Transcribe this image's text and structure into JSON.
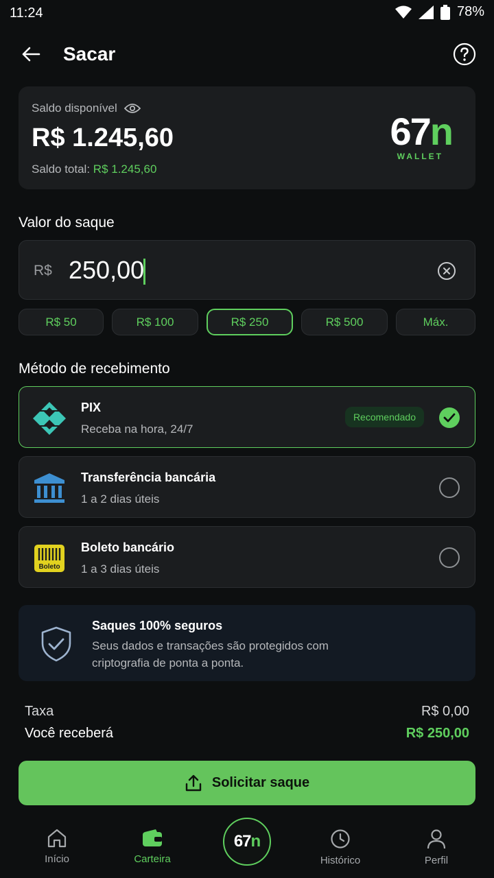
{
  "status_bar": {
    "time": "11:24",
    "battery": "78%"
  },
  "header": {
    "title": "Sacar"
  },
  "balance": {
    "label": "Saldo disponível",
    "value": "R$ 1.245,60",
    "total_label": "Saldo total:",
    "total_value": "R$ 1.245,60",
    "logo_main": "67",
    "logo_n": "n",
    "logo_sub": "WALLET"
  },
  "amount": {
    "section_title": "Valor do saque",
    "currency": "R$",
    "value": "250,00",
    "chips": [
      "R$ 50",
      "R$ 100",
      "R$ 250",
      "R$ 500",
      "Máx."
    ],
    "selected_chip": "R$ 250"
  },
  "methods": {
    "section_title": "Método de recebimento",
    "items": [
      {
        "title": "PIX",
        "subtitle": "Receba na hora, 24/7",
        "badge": "Recomendado",
        "selected": true,
        "icon": "pix-icon"
      },
      {
        "title": "Transferência bancária",
        "subtitle": "1 a 2 dias úteis",
        "selected": false,
        "icon": "bank-icon"
      },
      {
        "title": "Boleto bancário",
        "subtitle": "1 a 3 dias úteis",
        "selected": false,
        "icon": "boleto-icon",
        "icon_text": "Boleto"
      }
    ]
  },
  "security": {
    "title": "Saques 100% seguros",
    "body": "Seus dados e transações são protegidos com criptografia de ponta a ponta."
  },
  "summary": {
    "fee_label": "Taxa",
    "fee_value": "R$ 0,00",
    "receive_label": "Você receberá",
    "receive_value": "R$ 250,00"
  },
  "cta": {
    "label": "Solicitar saque"
  },
  "nav": {
    "items": [
      {
        "label": "Início",
        "icon": "home-icon"
      },
      {
        "label": "Carteira",
        "icon": "wallet-icon",
        "active": true
      },
      {
        "label": "Histórico",
        "icon": "history-icon"
      },
      {
        "label": "Perfil",
        "icon": "profile-icon"
      }
    ],
    "center_main": "67",
    "center_n": "n"
  },
  "colors": {
    "accent": "#5fcf5e",
    "background": "#0d0f10",
    "card": "#1b1d1f",
    "cta": "#64c45c"
  }
}
